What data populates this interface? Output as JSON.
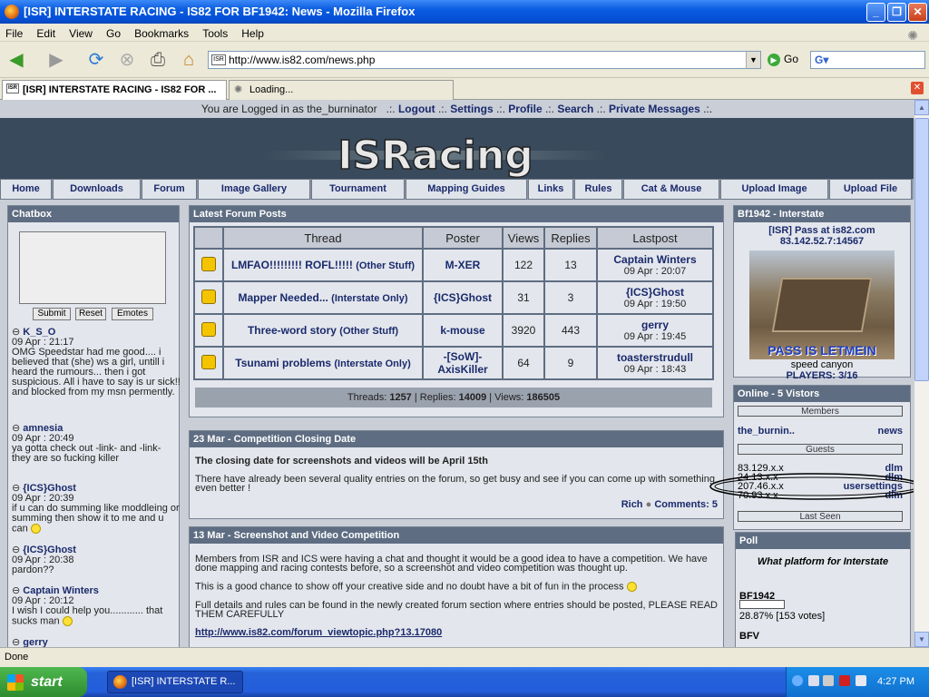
{
  "window": {
    "title": "[ISR] INTERSTATE RACING - IS82 FOR BF1942: News - Mozilla Firefox"
  },
  "menu": [
    "File",
    "Edit",
    "View",
    "Go",
    "Bookmarks",
    "Tools",
    "Help"
  ],
  "address": {
    "url": "http://www.is82.com/news.php",
    "go": "Go"
  },
  "tabs": [
    {
      "label": "[ISR] INTERSTATE RACING - IS82 FOR ..."
    },
    {
      "label": "Loading..."
    }
  ],
  "status": "Done",
  "taskbar": {
    "start": "start",
    "task": "[ISR] INTERSTATE R...",
    "time": "4:27 PM"
  },
  "page": {
    "login": {
      "text": "You are Logged in as the_burninator",
      "links": [
        "Logout",
        "Settings",
        "Profile",
        "Search",
        "Private Messages"
      ]
    },
    "logo": "ISRacing",
    "nav": [
      "Home",
      "Downloads",
      "Forum",
      "Image Gallery",
      "Tournament",
      "Mapping Guides",
      "Links",
      "Rules",
      "Cat & Mouse",
      "Upload Image",
      "Upload File"
    ],
    "chatbox": {
      "title": "Chatbox",
      "buttons": [
        "Submit",
        "Reset",
        "Emotes"
      ],
      "messages": [
        {
          "name": "K_S_O",
          "time": "09 Apr : 21:17",
          "text": "OMG Speedstar had me good.... i believed that (she) ws a girl, untill i heard the rumours... then i got suspicious. All i have to say is ur sick!! and blocked from my msn permently."
        },
        {
          "name": "amnesia",
          "time": "09 Apr : 20:49",
          "text": "ya gotta check out -link- and -link- they are so fucking killer"
        },
        {
          "name": "{ICS}Ghost",
          "time": "09 Apr : 20:39",
          "text": "if u can do summing like moddleing or summing then show it to me and u can"
        },
        {
          "name": "{ICS}Ghost",
          "time": "09 Apr : 20:38",
          "text": "pardon??"
        },
        {
          "name": "Captain Winters",
          "time": "09 Apr : 20:12",
          "text": "I wish I could help you............ that sucks man"
        },
        {
          "name": "gerry",
          "time": "",
          "text": ""
        }
      ]
    },
    "forum": {
      "title": "Latest Forum Posts",
      "headers": [
        "Thread",
        "Poster",
        "Views",
        "Replies",
        "Lastpost"
      ],
      "rows": [
        {
          "thread": "LMFAO!!!!!!!!! ROFL!!!!!",
          "cat": "(Other Stuff)",
          "poster": "M-XER",
          "views": "122",
          "replies": "13",
          "lp_name": "Captain Winters",
          "lp_date": "09 Apr : 20:07"
        },
        {
          "thread": "Mapper Needed...",
          "cat": "(Interstate Only)",
          "poster": "{ICS}Ghost",
          "views": "31",
          "replies": "3",
          "lp_name": "{ICS}Ghost",
          "lp_date": "09 Apr : 19:50"
        },
        {
          "thread": "Three-word story",
          "cat": "(Other Stuff)",
          "poster": "k-mouse",
          "views": "3920",
          "replies": "443",
          "lp_name": "gerry",
          "lp_date": "09 Apr : 19:45"
        },
        {
          "thread": "Tsunami problems",
          "cat": "(Interstate Only)",
          "poster": "-[SoW]-AxisKiller",
          "views": "64",
          "replies": "9",
          "lp_name": "toasterstrudull",
          "lp_date": "09 Apr : 18:43"
        }
      ],
      "totals": {
        "threads": "1257",
        "replies": "14009",
        "views": "186505"
      }
    },
    "news1": {
      "title": "23 Mar - Competition Closing Date",
      "headline": "The closing date for screenshots and videos will be April 15th",
      "body": "There have already been several quality entries on the forum, so get busy and see if you can come up with something even better !",
      "author": "Rich",
      "comments": "Comments: 5"
    },
    "news2": {
      "title": "13 Mar - Screenshot and Video Competition",
      "p1": "Members from ISR and ICS were having a chat and thought it would be a good idea to have a competition. We have done mapping and racing contests before, so a screenshot and video competition was thought up.",
      "p2": "This is a good chance to show off your creative side and no doubt have a bit of fun in the process",
      "p3": "Full details and rules can be found in the newly created forum section where entries should be posted, PLEASE READ THEM CAREFULLY",
      "link": "http://www.is82.com/forum_viewtopic.php?13.17080"
    },
    "server": {
      "title": "Bf1942 - Interstate",
      "name": "[ISR] Pass at is82.com",
      "ip": "83.142.52.7:14567",
      "pass": "PASS IS LETMEIN",
      "map": "speed canyon",
      "players": "PLAYERS: 3/16"
    },
    "online": {
      "title": "Online - 5 Vistors",
      "members_label": "Members",
      "member": {
        "name": "the_burnin..",
        "page": "news"
      },
      "guests_label": "Guests",
      "guests": [
        {
          "ip": "83.129.x.x",
          "page": "dlm"
        },
        {
          "ip": "24.13.x.x",
          "page": "dlm"
        },
        {
          "ip": "207.46.x.x",
          "page": "usersettings"
        },
        {
          "ip": "70.93.x.x",
          "page": "dlm"
        }
      ],
      "last_seen": "Last Seen"
    },
    "poll": {
      "title": "Poll",
      "question": "What platform for Interstate",
      "opt1": "BF1942",
      "opt1_result": "28.87% [153 votes]",
      "opt1_fraction": 0.2887,
      "opt2": "BFV"
    }
  }
}
